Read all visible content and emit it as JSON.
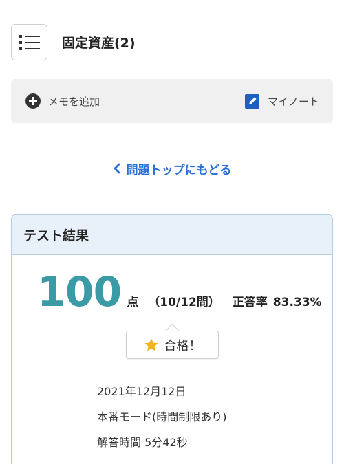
{
  "header": {
    "title": "固定資産(2)",
    "menu_icon": "list-icon"
  },
  "action_bar": {
    "memo_label": "メモを追加",
    "memo_icon": "plus-circle-icon",
    "note_label": "マイノート",
    "note_icon": "edit-note-icon"
  },
  "back_link": {
    "label": "問題トップにもどる",
    "icon": "chevron-left-icon"
  },
  "result": {
    "title": "テスト結果",
    "score": "100",
    "score_unit": "点",
    "count": "（10/12問）",
    "rate_label": "正答率",
    "rate_value": "83.33%",
    "pass_label": "合格！",
    "pass_icon": "star-icon",
    "date": "2021年12月12日",
    "mode": "本番モード(時間制限あり)",
    "time": "解答時間 5分42秒"
  },
  "colors": {
    "accent_blue": "#2a6fd6",
    "score_teal": "#3a9aa6",
    "star_gold": "#f2b21a",
    "card_header_bg": "#e8f0fa",
    "card_border": "#b7cde6"
  }
}
